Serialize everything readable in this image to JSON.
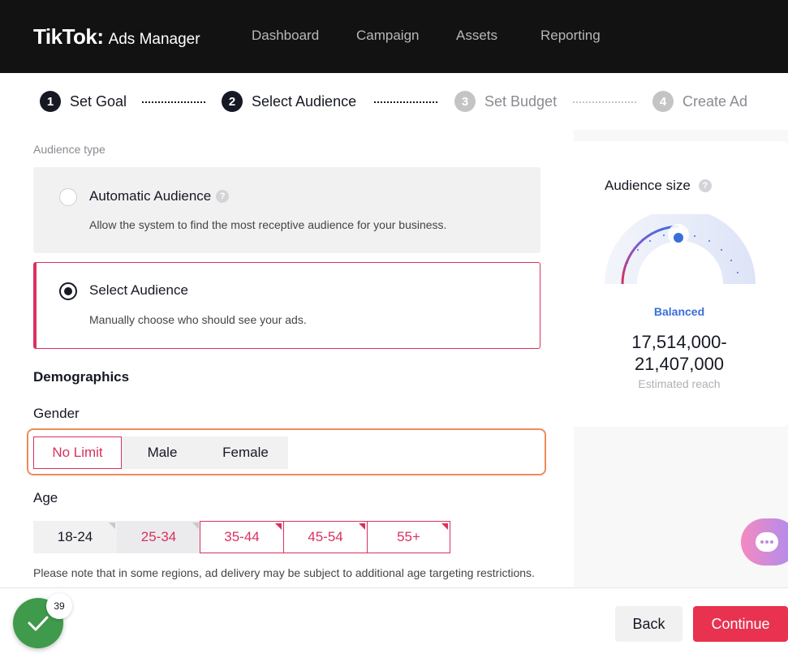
{
  "header": {
    "logo": "TikTok:",
    "product": "Ads Manager",
    "nav": [
      "Dashboard",
      "Campaign",
      "Assets",
      "Reporting"
    ]
  },
  "stepper": {
    "steps": [
      {
        "num": "1",
        "label": "Set Goal"
      },
      {
        "num": "2",
        "label": "Select Audience"
      },
      {
        "num": "3",
        "label": "Set Budget"
      },
      {
        "num": "4",
        "label": "Create Ad"
      }
    ]
  },
  "audience_type": {
    "label": "Audience type",
    "automatic": {
      "title": "Automatic Audience",
      "help": "?",
      "desc": "Allow the system to find the most receptive audience for your business."
    },
    "select": {
      "title": "Select Audience",
      "desc": "Manually choose who should see your ads."
    }
  },
  "demographics": {
    "heading": "Demographics",
    "gender": {
      "label": "Gender",
      "options": [
        "No Limit",
        "Male",
        "Female"
      ],
      "selected": "No Limit"
    },
    "age": {
      "label": "Age",
      "options": [
        "18-24",
        "25-34",
        "35-44",
        "45-54",
        "55+"
      ]
    },
    "note": "Please note that in some regions, ad delivery may be subject to additional age targeting restrictions."
  },
  "audience_size": {
    "title": "Audience size",
    "help": "?",
    "status": "Balanced",
    "reach_low": "17,514,000-",
    "reach_high": "21,407,000",
    "reach_label": "Estimated reach"
  },
  "footer": {
    "count": "39",
    "back": "Back",
    "continue": "Continue"
  },
  "colors": {
    "accent": "#e8324f",
    "selected_border": "#d9315e",
    "highlight": "#ef8a5b",
    "status_blue": "#3a6fd8",
    "success": "#3f9a4c"
  }
}
